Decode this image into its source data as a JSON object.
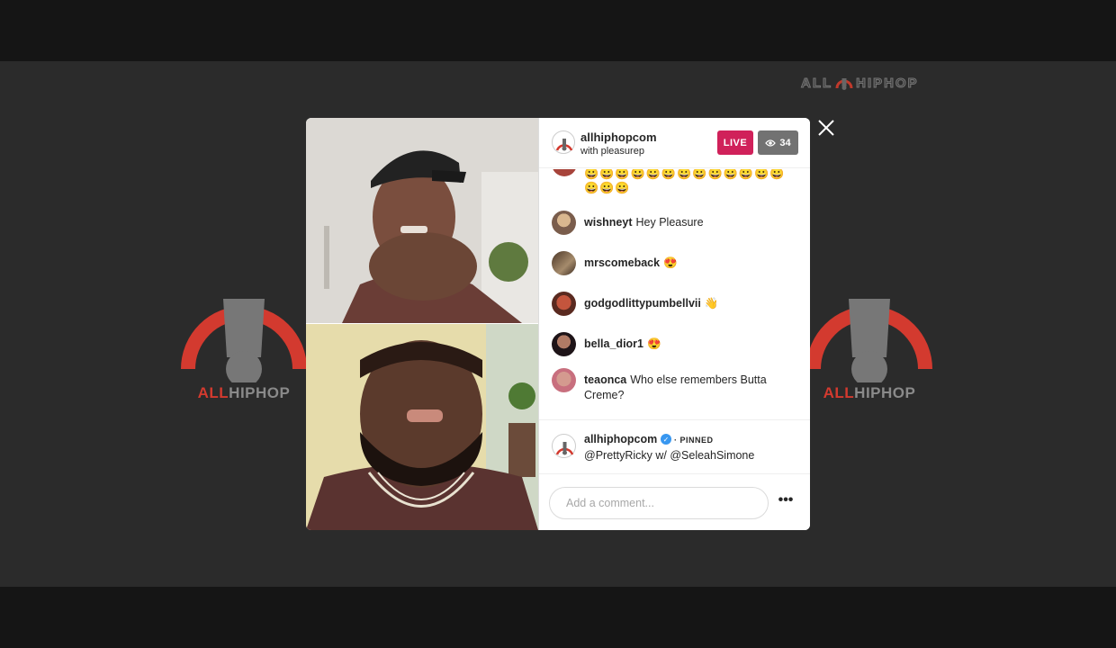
{
  "brand": {
    "word_part1": "ALL",
    "word_part2": "HIPHOP",
    "accent_color": "#d33a2f",
    "gray_color": "#8a8a8a"
  },
  "live_header": {
    "host": "allhiphopcom",
    "subtitle": "with pleasurep",
    "live_label": "LIVE",
    "viewer_count": "34",
    "live_color": "#d0215a"
  },
  "comments": {
    "emoji_line_1": "😀😀😀😀😀😀😀😀😀😀😀😀😀",
    "emoji_line_2": "😀😀😀",
    "items": [
      {
        "user": "wishneyt",
        "text": "Hey Pleasure"
      },
      {
        "user": "mrscomeback",
        "text": "😍"
      },
      {
        "user": "godgodlittypumbellvii",
        "text": "👋"
      },
      {
        "user": "bella_dior1",
        "text": "😍"
      },
      {
        "user": "teaonca",
        "text": "Who else remembers Butta Creme?"
      }
    ]
  },
  "pinned": {
    "user": "allhiphopcom",
    "label": "PINNED",
    "text": "@PrettyRicky w/ @SeleahSimone"
  },
  "composer": {
    "placeholder": "Add a comment...",
    "more_label": "•••"
  },
  "icons": {
    "close": "close-icon",
    "eye": "eye-icon",
    "verified": "verified-badge-icon",
    "microphone": "microphone-logo-icon"
  }
}
